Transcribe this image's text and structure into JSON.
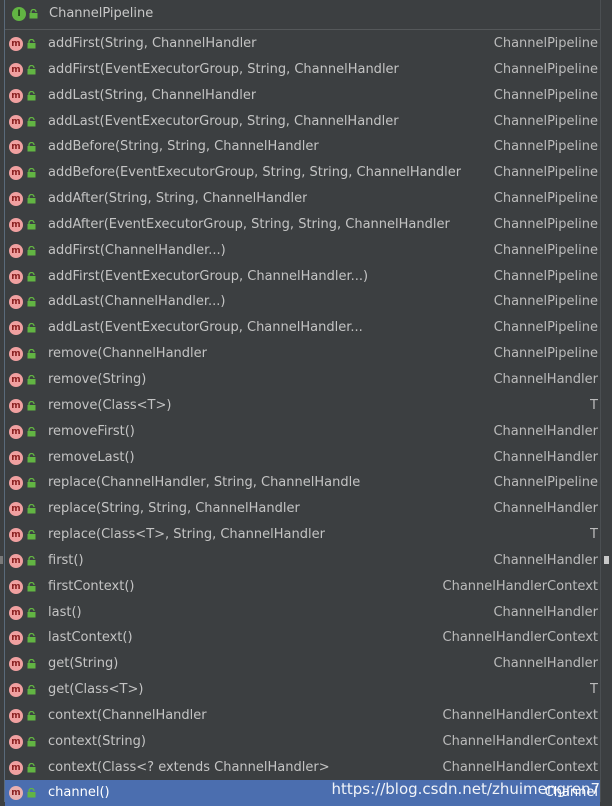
{
  "header": {
    "title": "ChannelPipeline",
    "class_icon_letter": "I"
  },
  "icon_letter": "m",
  "rows": [
    {
      "sig": "addFirst(String, ChannelHandler",
      "ret": "ChannelPipeline"
    },
    {
      "sig": "addFirst(EventExecutorGroup, String, ChannelHandler",
      "ret": "ChannelPipeline"
    },
    {
      "sig": "addLast(String, ChannelHandler",
      "ret": "ChannelPipeline"
    },
    {
      "sig": "addLast(EventExecutorGroup, String, ChannelHandler",
      "ret": "ChannelPipeline"
    },
    {
      "sig": "addBefore(String, String, ChannelHandler",
      "ret": "ChannelPipeline"
    },
    {
      "sig": "addBefore(EventExecutorGroup, String, String, ChannelHandler",
      "ret": "ChannelPipeline"
    },
    {
      "sig": "addAfter(String, String, ChannelHandler",
      "ret": "ChannelPipeline"
    },
    {
      "sig": "addAfter(EventExecutorGroup, String, String, ChannelHandler",
      "ret": "ChannelPipeline"
    },
    {
      "sig": "addFirst(ChannelHandler...)",
      "ret": "ChannelPipeline"
    },
    {
      "sig": "addFirst(EventExecutorGroup, ChannelHandler...)",
      "ret": "ChannelPipeline"
    },
    {
      "sig": "addLast(ChannelHandler...)",
      "ret": "ChannelPipeline"
    },
    {
      "sig": "addLast(EventExecutorGroup, ChannelHandler...",
      "ret": "ChannelPipeline"
    },
    {
      "sig": "remove(ChannelHandler",
      "ret": "ChannelPipeline"
    },
    {
      "sig": "remove(String)",
      "ret": "ChannelHandler"
    },
    {
      "sig": "remove(Class<T>)",
      "ret": "T"
    },
    {
      "sig": "removeFirst()",
      "ret": "ChannelHandler"
    },
    {
      "sig": "removeLast()",
      "ret": "ChannelHandler"
    },
    {
      "sig": "replace(ChannelHandler, String, ChannelHandle",
      "ret": "ChannelPipeline"
    },
    {
      "sig": "replace(String, String, ChannelHandler",
      "ret": "ChannelHandler"
    },
    {
      "sig": "replace(Class<T>, String, ChannelHandler",
      "ret": "T"
    },
    {
      "sig": "first()",
      "ret": "ChannelHandler"
    },
    {
      "sig": "firstContext()",
      "ret": "ChannelHandlerContext"
    },
    {
      "sig": "last()",
      "ret": "ChannelHandler"
    },
    {
      "sig": "lastContext()",
      "ret": "ChannelHandlerContext"
    },
    {
      "sig": "get(String)",
      "ret": "ChannelHandler"
    },
    {
      "sig": "get(Class<T>)",
      "ret": "T"
    },
    {
      "sig": "context(ChannelHandler",
      "ret": "ChannelHandlerContext"
    },
    {
      "sig": "context(String)",
      "ret": "ChannelHandlerContext"
    },
    {
      "sig": "context(Class<? extends ChannelHandler>",
      "ret": "ChannelHandlerContext"
    },
    {
      "sig": "channel()",
      "ret": "Channel",
      "selected": true
    }
  ],
  "watermark": "https://blog.csdn.net/zhuimengren7",
  "colors": {
    "background": "#3c3f41",
    "selection": "#4b6eaf",
    "method_icon": "#f0a0a0",
    "class_icon": "#62b543",
    "lock": "#62b543"
  }
}
